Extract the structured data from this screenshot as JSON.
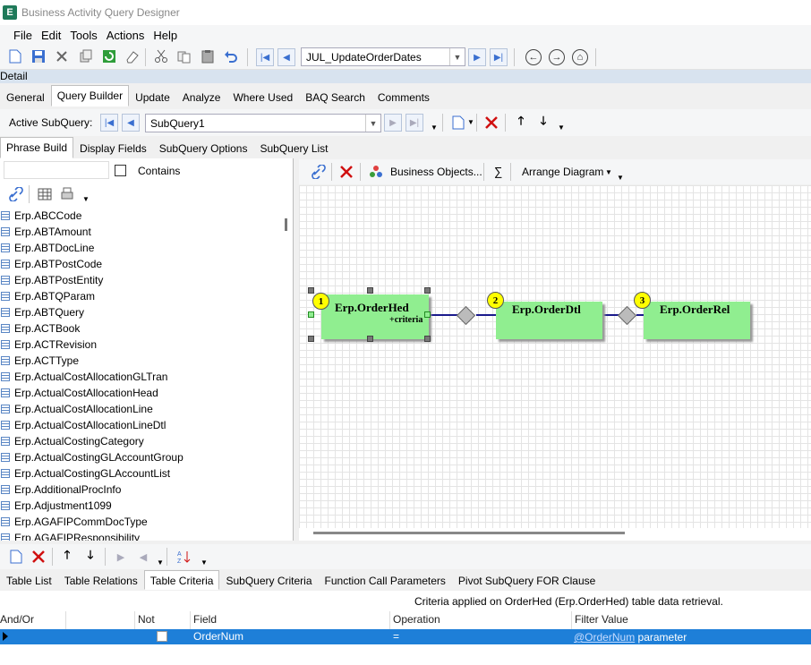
{
  "window": {
    "title": "Business Activity Query Designer",
    "app_icon_letter": "E"
  },
  "menu": [
    "File",
    "Edit",
    "Tools",
    "Actions",
    "Help"
  ],
  "main_toolbar": {
    "query_id": "JUL_UpdateOrderDates"
  },
  "detail_label": "Detail",
  "main_tabs": [
    "General",
    "Query Builder",
    "Update",
    "Analyze",
    "Where Used",
    "BAQ Search",
    "Comments"
  ],
  "main_tabs_active": "Query Builder",
  "subquery": {
    "label": "Active SubQuery:",
    "value": "SubQuery1"
  },
  "sub_tabs": [
    "Phrase Build",
    "Display Fields",
    "SubQuery Options",
    "SubQuery List"
  ],
  "sub_tabs_active": "Phrase Build",
  "search": {
    "value": "",
    "contains_label": "Contains",
    "contains_checked": false
  },
  "tables": [
    "Erp.ABCCode",
    "Erp.ABTAmount",
    "Erp.ABTDocLine",
    "Erp.ABTPostCode",
    "Erp.ABTPostEntity",
    "Erp.ABTQParam",
    "Erp.ABTQuery",
    "Erp.ACTBook",
    "Erp.ACTRevision",
    "Erp.ACTType",
    "Erp.ActualCostAllocationGLTran",
    "Erp.ActualCostAllocationHead",
    "Erp.ActualCostAllocationLine",
    "Erp.ActualCostAllocationLineDtl",
    "Erp.ActualCostingCategory",
    "Erp.ActualCostingGLAccountGroup",
    "Erp.ActualCostingGLAccountList",
    "Erp.AdditionalProcInfo",
    "Erp.Adjustment1099",
    "Erp.AGAFIPCommDocType",
    "Erp.AGAFIPResponsibility"
  ],
  "diagram_toolbar": {
    "business_objects": "Business Objects...",
    "sum_symbol": "∑",
    "arrange": "Arrange Diagram"
  },
  "diagram": {
    "nodes": [
      {
        "num": "1",
        "title": "Erp.OrderHed",
        "note": "+criteria"
      },
      {
        "num": "2",
        "title": "Erp.OrderDtl",
        "note": ""
      },
      {
        "num": "3",
        "title": "Erp.OrderRel",
        "note": ""
      }
    ]
  },
  "bottom_tabs": [
    "Table List",
    "Table Relations",
    "Table Criteria",
    "SubQuery Criteria",
    "Function Call Parameters",
    "Pivot SubQuery FOR Clause"
  ],
  "bottom_tabs_active": "Table Criteria",
  "criteria": {
    "caption": "Criteria applied on OrderHed (Erp.OrderHed)  table data retrieval.",
    "columns": [
      "And/Or",
      "Not",
      "Field",
      "Operation",
      "Filter Value"
    ],
    "rows": [
      {
        "and_or": "",
        "not": false,
        "field": "OrderNum",
        "operation": "=",
        "filter_link": "@OrderNum",
        "filter_suffix": " parameter"
      }
    ]
  },
  "colors": {
    "selection": "#1e7fd8",
    "node_fill": "#90ee90",
    "number_badge": "#ffff00",
    "link": "#1a1a8c"
  }
}
